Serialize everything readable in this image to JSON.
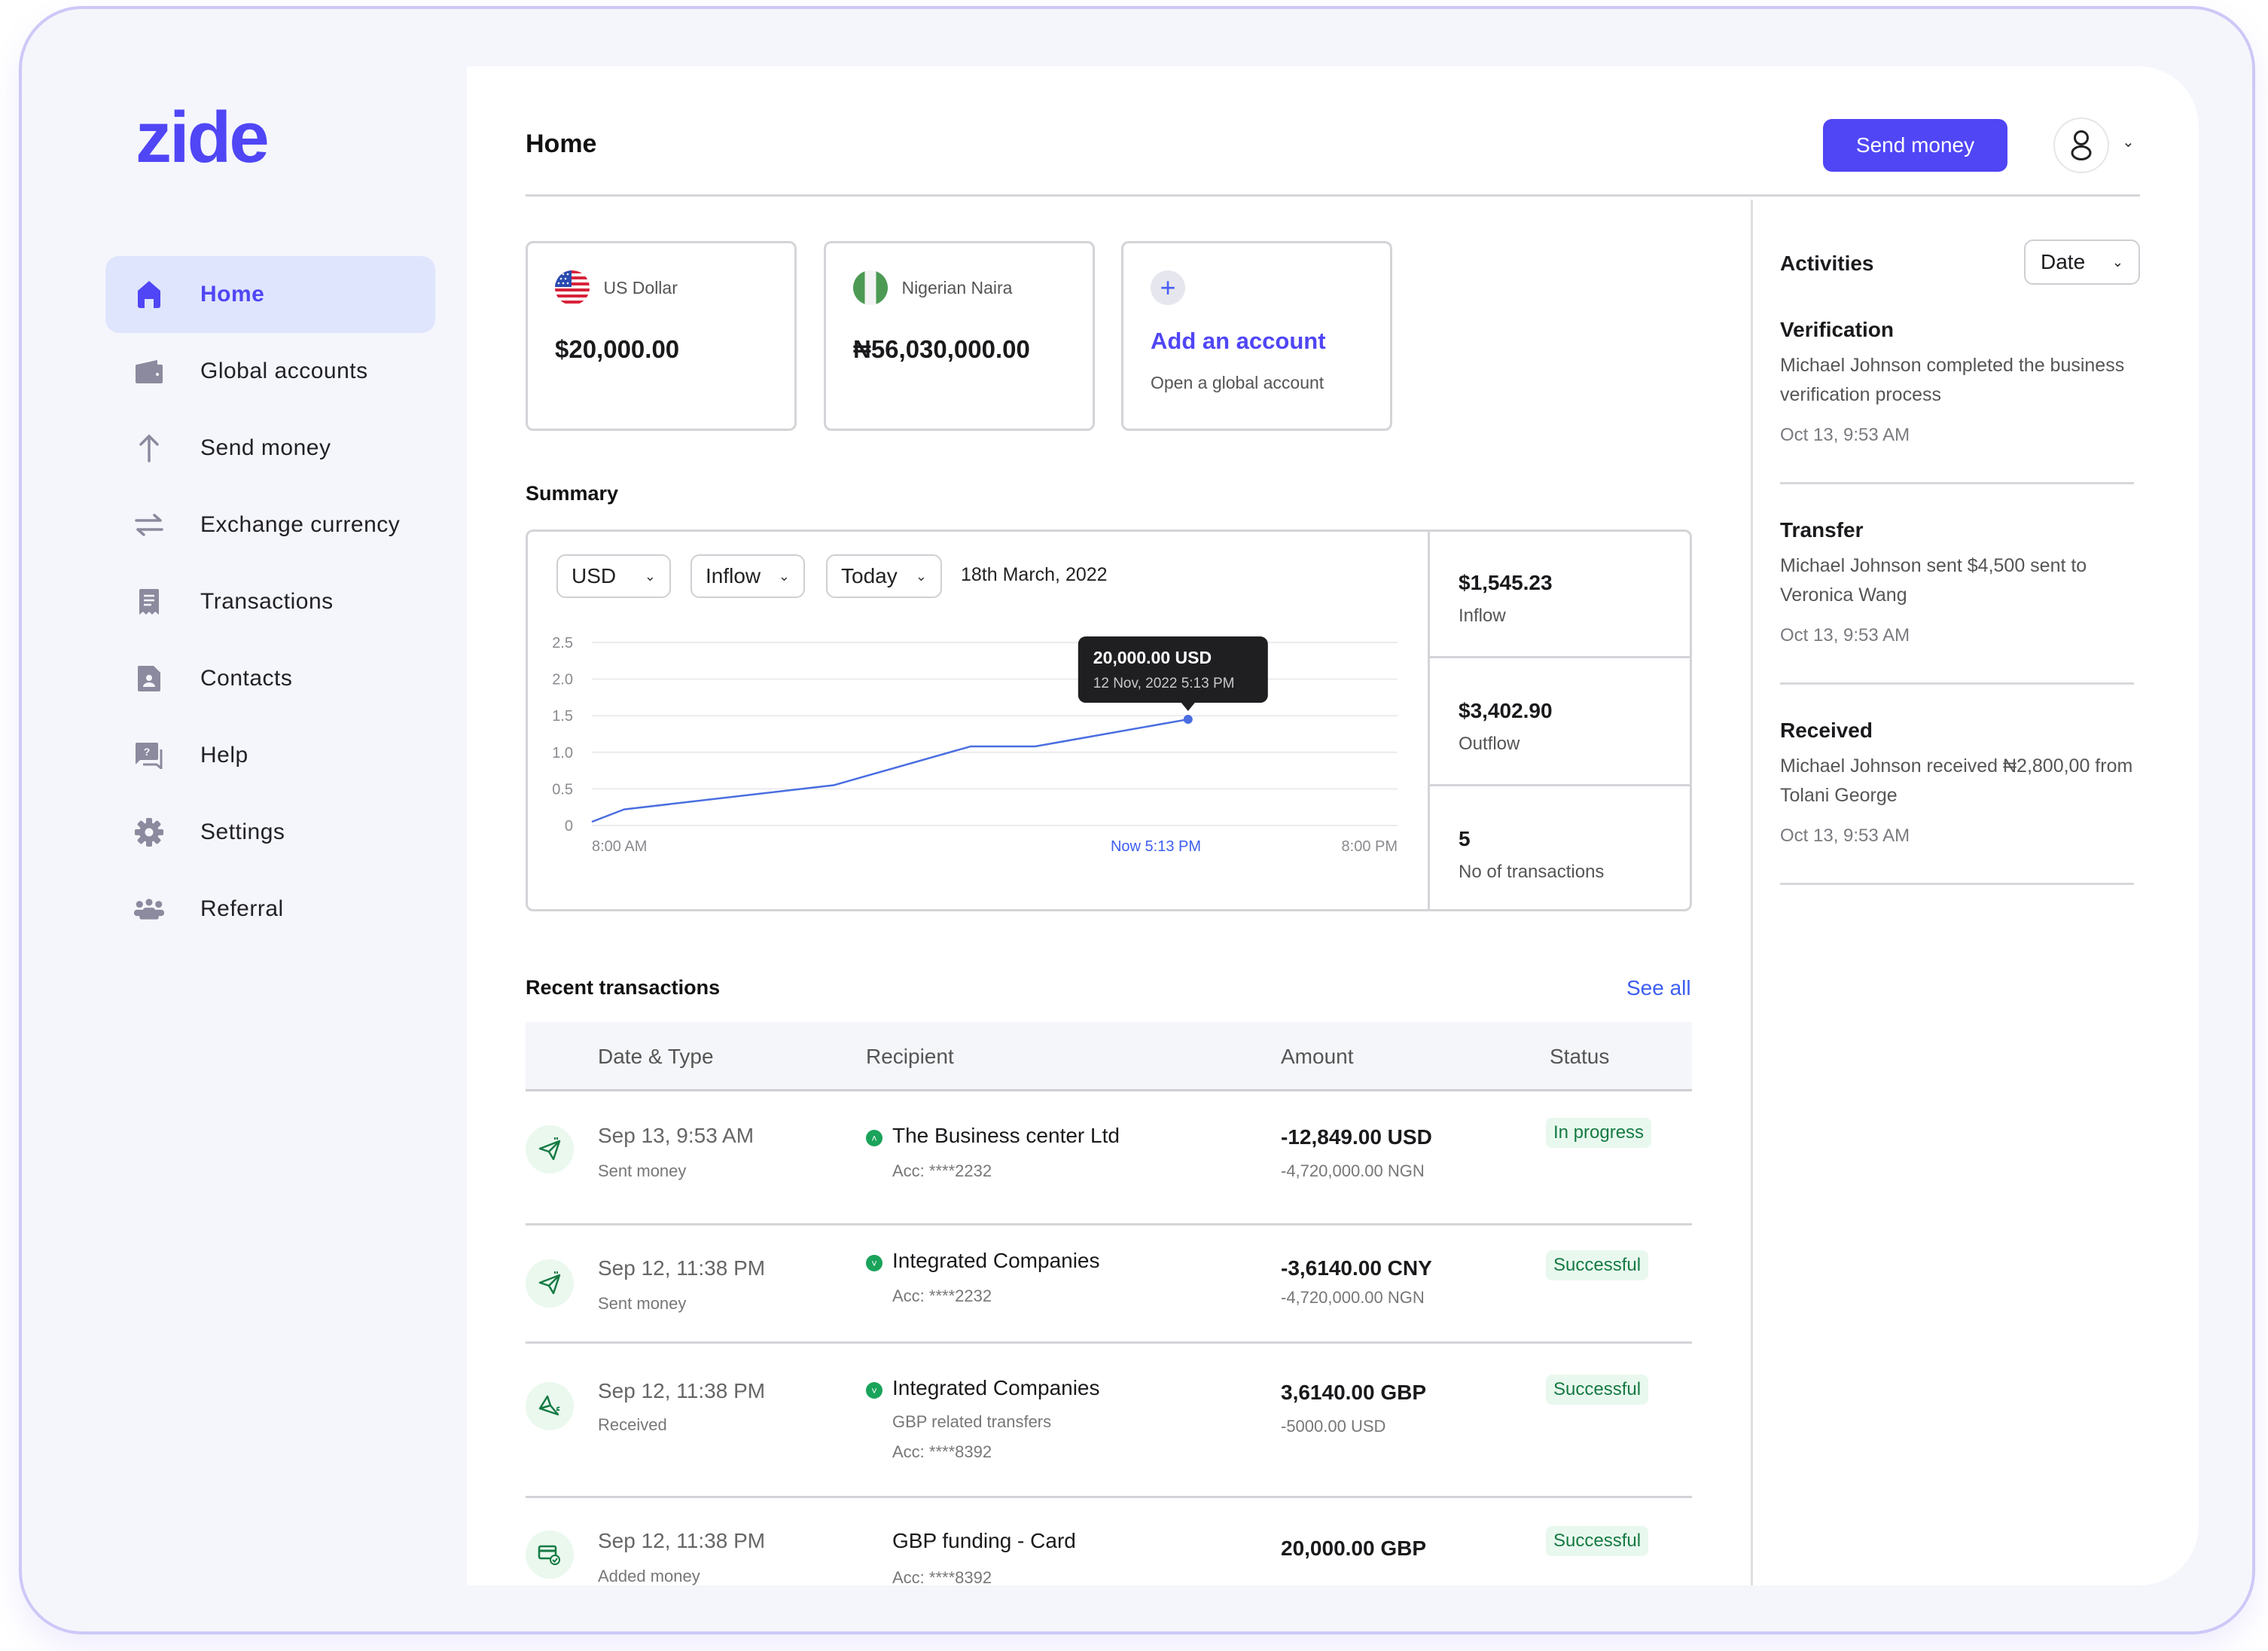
{
  "brand": {
    "logo": "zide",
    "accent": "#5046f5"
  },
  "sidebar": {
    "items": [
      {
        "label": "Home",
        "icon": "home-icon",
        "active": true
      },
      {
        "label": "Global accounts",
        "icon": "wallet-icon",
        "active": false
      },
      {
        "label": "Send money",
        "icon": "arrow-up-icon",
        "active": false
      },
      {
        "label": "Exchange currency",
        "icon": "exchange-icon",
        "active": false
      },
      {
        "label": "Transactions",
        "icon": "receipt-icon",
        "active": false
      },
      {
        "label": "Contacts",
        "icon": "contact-card-icon",
        "active": false
      },
      {
        "label": "Help",
        "icon": "help-chat-icon",
        "active": false
      },
      {
        "label": "Settings",
        "icon": "gear-icon",
        "active": false
      },
      {
        "label": "Referral",
        "icon": "group-icon",
        "active": false
      }
    ]
  },
  "header": {
    "title": "Home",
    "send_money_label": "Send money",
    "avatar_icon": "user-icon"
  },
  "accounts": [
    {
      "currency": "US Dollar",
      "balance": "$20,000.00",
      "flag": "us-flag-icon"
    },
    {
      "currency": "Nigerian Naira",
      "balance": "₦56,030,000.00",
      "flag": "ng-flag-icon"
    }
  ],
  "add_account": {
    "title": "Add an account",
    "subtitle": "Open a global account"
  },
  "summary": {
    "label": "Summary",
    "filters": {
      "currency": "USD",
      "flow": "Inflow",
      "period": "Today"
    },
    "date": "18th March, 2022",
    "stats": [
      {
        "value": "$1,545.23",
        "caption": "Inflow"
      },
      {
        "value": "$3,402.90",
        "caption": "Outflow"
      },
      {
        "value": "5",
        "caption": "No of transactions"
      }
    ]
  },
  "chart_data": {
    "type": "line",
    "title": "",
    "xlabel": "",
    "ylabel": "",
    "x_tick_labels": [
      "8:00 AM",
      "Now 5:13 PM",
      "8:00 PM"
    ],
    "x_tick_positions": [
      0,
      0.7,
      1
    ],
    "x_range": [
      0,
      1
    ],
    "y_ticks": [
      0,
      0.5,
      1.0,
      1.5,
      2.0,
      2.5
    ],
    "y_tick_labels": [
      "0",
      "0.5",
      "1.0",
      "1.5",
      "2.0",
      "2.5"
    ],
    "ylim": [
      0,
      2.5
    ],
    "grid": true,
    "series": [
      {
        "name": "Inflow",
        "color": "#4a6ee0",
        "x": [
          0.0,
          0.04,
          0.3,
          0.47,
          0.55,
          0.74
        ],
        "y": [
          0.05,
          0.22,
          0.55,
          1.08,
          1.08,
          1.45
        ]
      }
    ],
    "tooltip": {
      "value": "20,000.00 USD",
      "date": "12 Nov, 2022  5:13 PM",
      "point_index": 5
    }
  },
  "transactions": {
    "label": "Recent transactions",
    "see_all": "See all",
    "columns": [
      "Date & Type",
      "Recipient",
      "Amount",
      "Status"
    ],
    "rows": [
      {
        "icon": "send-plane-icon",
        "date": "Sep 13, 9:53 AM",
        "type": "Sent money",
        "recipient": "The Business center Ltd",
        "recipient_sub": "",
        "account": "Acc: ****2232",
        "amount": "-12,849.00 USD",
        "amount_sub": "-4,720,000.00 NGN",
        "status": "In progress",
        "verified": true
      },
      {
        "icon": "send-plane-icon",
        "date": "Sep 12, 11:38 PM",
        "type": "Sent money",
        "recipient": "Integrated Companies",
        "recipient_sub": "",
        "account": "Acc: ****2232",
        "amount": "-3,6140.00 CNY",
        "amount_sub": "-4,720,000.00 NGN",
        "status": "Successful",
        "verified": true
      },
      {
        "icon": "receive-plane-icon",
        "date": "Sep 12, 11:38 PM",
        "type": "Received",
        "recipient": "Integrated Companies",
        "recipient_sub": "GBP related transfers",
        "account": "Acc: ****8392",
        "amount": "3,6140.00 GBP",
        "amount_sub": "-5000.00 USD",
        "status": "Successful",
        "verified": true
      },
      {
        "icon": "card-funding-icon",
        "date": "Sep 12, 11:38 PM",
        "type": "Added money",
        "recipient": "GBP funding - Card",
        "recipient_sub": "",
        "account": "Acc: ****8392",
        "amount": "20,000.00 GBP",
        "amount_sub": "",
        "status": "Successful",
        "verified": false
      }
    ]
  },
  "activities": {
    "title": "Activities",
    "filter": "Date",
    "items": [
      {
        "title": "Verification",
        "description": "Michael Johnson completed the business verification process",
        "time": "Oct 13, 9:53 AM"
      },
      {
        "title": "Transfer",
        "description": "Michael Johnson sent $4,500 sent to Veronica Wang",
        "time": "Oct 13, 9:53 AM"
      },
      {
        "title": "Received",
        "description": "Michael Johnson received ₦2,800,00 from Tolani George",
        "time": "Oct 13, 9:53 AM"
      }
    ]
  }
}
